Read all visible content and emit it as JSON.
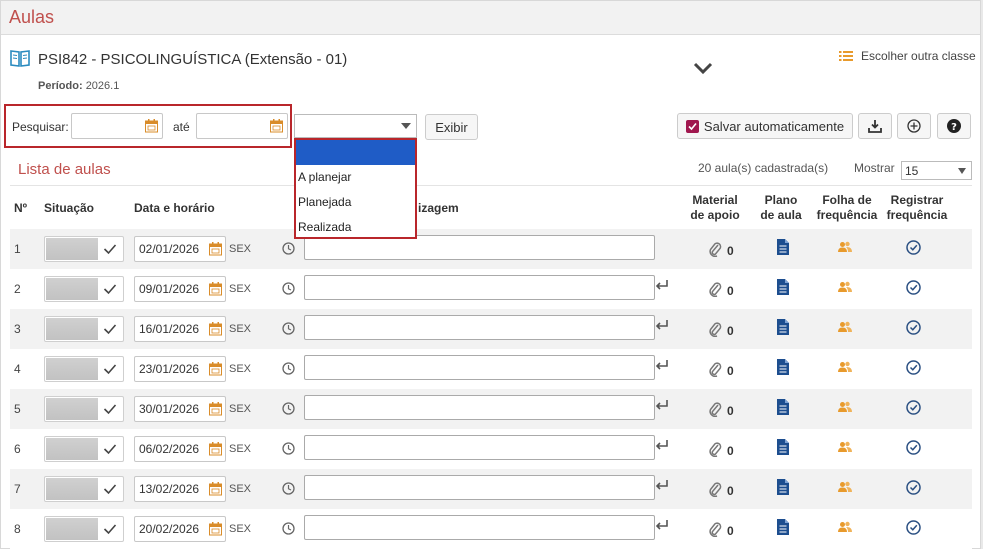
{
  "page": {
    "title": "Aulas"
  },
  "course": {
    "title": "PSI842 - PSICOLINGUÍSTICA (Extensão - 01)",
    "period_label": "Período:",
    "period_value": "2026.1",
    "choose_class_label": "Escolher outra classe"
  },
  "filters": {
    "search_label": "Pesquisar:",
    "until_label": "até",
    "from_value": "",
    "to_value": "",
    "status_value": "",
    "status_options": [
      "",
      "A planejar",
      "Planejada",
      "Realizada"
    ],
    "show_button": "Exibir",
    "autosave_label": "Salvar automaticamente",
    "autosave_checked": true
  },
  "list": {
    "title": "Lista de aulas",
    "count_text": "20 aula(s) cadastrada(s)",
    "show_label": "Mostrar",
    "page_size": "15"
  },
  "table": {
    "headers": {
      "num": "Nº",
      "status": "Situação",
      "date": "Data e horário",
      "content": "izagem",
      "material_1": "Material",
      "material_2": "de apoio",
      "plan_1": "Plano",
      "plan_2": "de aula",
      "sheet_1": "Folha de",
      "sheet_2": "frequência",
      "reg_1": "Registrar",
      "reg_2": "frequência"
    },
    "rows": [
      {
        "num": "1",
        "date": "02/01/2026",
        "weekday": "SEX",
        "materials": "0"
      },
      {
        "num": "2",
        "date": "09/01/2026",
        "weekday": "SEX",
        "materials": "0"
      },
      {
        "num": "3",
        "date": "16/01/2026",
        "weekday": "SEX",
        "materials": "0"
      },
      {
        "num": "4",
        "date": "23/01/2026",
        "weekday": "SEX",
        "materials": "0"
      },
      {
        "num": "5",
        "date": "30/01/2026",
        "weekday": "SEX",
        "materials": "0"
      },
      {
        "num": "6",
        "date": "06/02/2026",
        "weekday": "SEX",
        "materials": "0"
      },
      {
        "num": "7",
        "date": "13/02/2026",
        "weekday": "SEX",
        "materials": "0"
      },
      {
        "num": "8",
        "date": "20/02/2026",
        "weekday": "SEX",
        "materials": "0"
      }
    ]
  },
  "colors": {
    "title": "#c0504d",
    "highlight_border": "#b9262b",
    "selected_option": "#1f5cc6",
    "doc_icon": "#1d4e8f",
    "people_icon": "#e89a2c",
    "calendar_icon": "#d98c2a",
    "reg_icon": "#2a4f82",
    "checkbox": "#a0174e"
  },
  "icons": [
    "book-icon",
    "chevron-down-icon",
    "list-icon",
    "calendar-icon",
    "download-icon",
    "add-circle-icon",
    "help-icon",
    "check-icon",
    "clock-icon",
    "enter-icon",
    "paperclip-icon",
    "document-icon",
    "people-icon",
    "check-circle-icon"
  ]
}
